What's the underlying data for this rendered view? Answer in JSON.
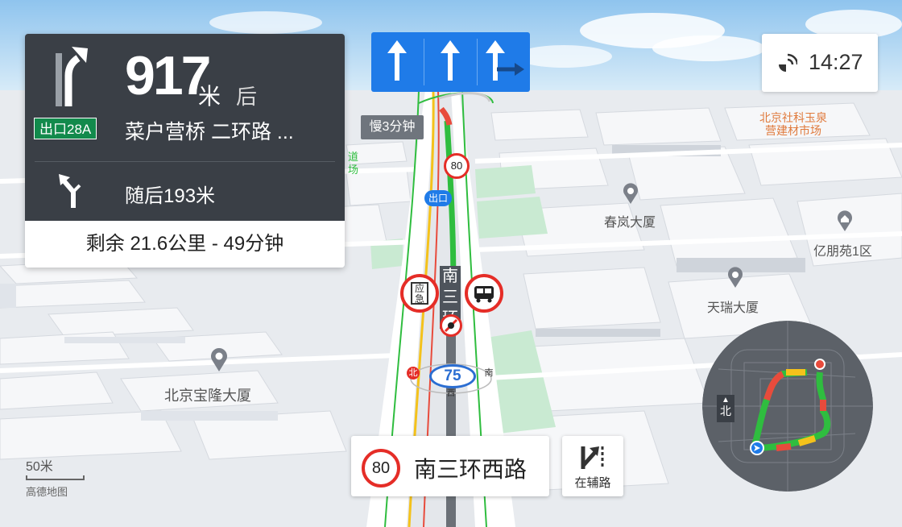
{
  "maneuver": {
    "distance_value": "917",
    "distance_unit": "米",
    "distance_suffix": "后",
    "exit_label": "出口28A",
    "road_name": "菜户营桥 二环路 ...",
    "next_instruction": "随后193米",
    "remaining": "剩余 21.6公里 - 49分钟",
    "turn_icon": "keep-right-arrow",
    "next_icon": "fork-left-arrow"
  },
  "lanes": [
    "straight",
    "straight",
    "straight-right"
  ],
  "status": {
    "clock": "14:27",
    "gps_icon": "satellite-icon"
  },
  "traffic": {
    "delay_tag": "慢3分钟"
  },
  "map": {
    "road_signs": {
      "speed_limit_ahead": "80",
      "exit_marker": "出口",
      "lane_speed": "75",
      "road_vertical": "南三环西路"
    },
    "pois": {
      "building_1": "春岚大厦",
      "building_2": "亿朋苑1区",
      "building_3": "天瑞大厦",
      "building_4": "北京宝隆大厦",
      "market_line1": "北京社科玉泉",
      "market_line2": "营建材市场",
      "road_fragment_1": "道",
      "road_fragment_2": "场"
    },
    "badges": {
      "emergency": "应急",
      "emergency_line1": "应",
      "emergency_line2": "急",
      "bus_icon": "bus-icon"
    },
    "marker_labels": {
      "north": "北",
      "south": "南",
      "west": "西"
    }
  },
  "bottom": {
    "speed_limit": "80",
    "current_road": "南三环西路",
    "aux_road_label": "在辅路"
  },
  "scale": {
    "value": "50米",
    "logo": "高德地图"
  },
  "minimap": {
    "compass": "北"
  },
  "colors": {
    "panel_dark": "#3a3f46",
    "lane_blue": "#1f7be8",
    "exit_green": "#128a4c",
    "route_green": "#2fbd3f",
    "speed_red": "#e52d27"
  }
}
